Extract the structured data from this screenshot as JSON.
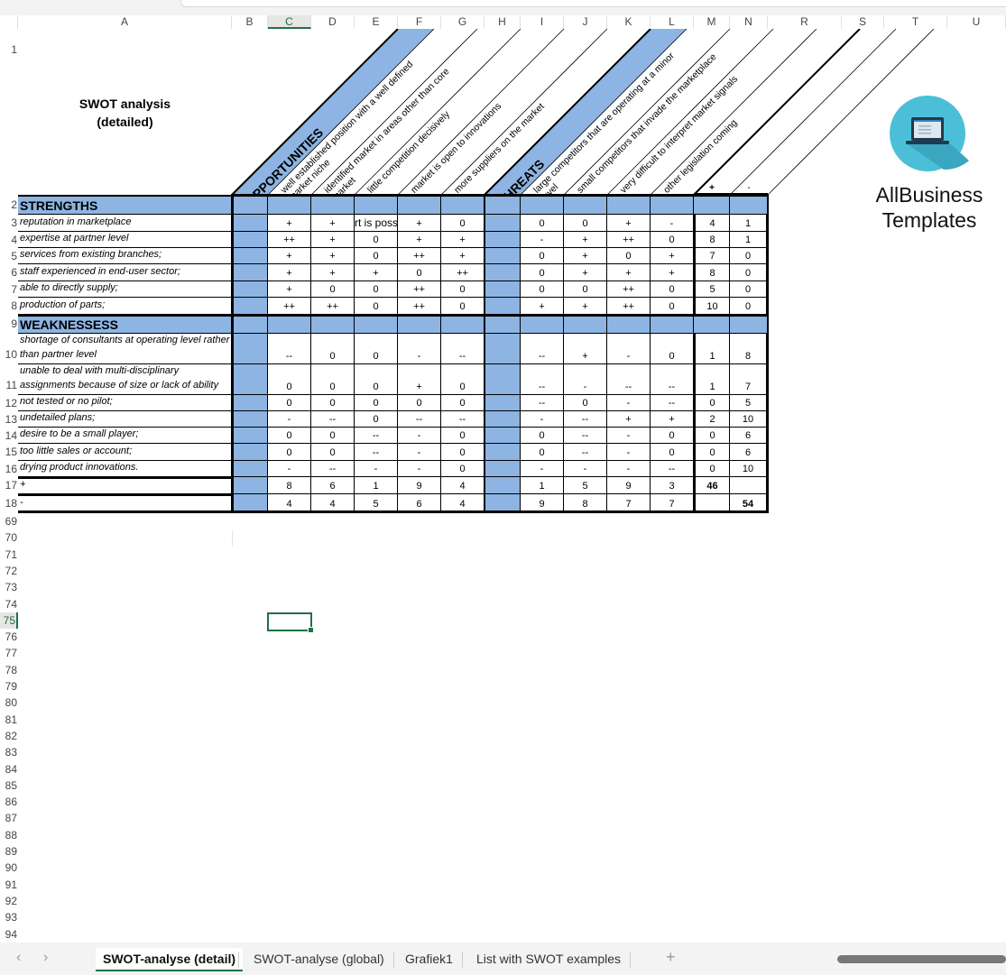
{
  "sheet": {
    "columns": [
      "A",
      "B",
      "C",
      "D",
      "E",
      "F",
      "G",
      "H",
      "I",
      "J",
      "K",
      "L",
      "M",
      "N",
      "R",
      "S",
      "T",
      "U"
    ],
    "selected_column": "C",
    "selected_row": "75",
    "rows_top": [
      "1",
      "2",
      "3",
      "4",
      "5",
      "6",
      "7",
      "8",
      "9",
      "10",
      "11",
      "12",
      "13",
      "14",
      "15",
      "16",
      "17",
      "18"
    ],
    "rows_bottom": [
      "69",
      "70",
      "71",
      "72",
      "73",
      "74",
      "75",
      "76",
      "77",
      "78",
      "79",
      "80",
      "81",
      "82",
      "83",
      "84",
      "85",
      "86",
      "87",
      "88",
      "89",
      "90",
      "91",
      "92",
      "93",
      "94"
    ]
  },
  "title": {
    "line1": "SWOT analysis",
    "line2": "(detailed)"
  },
  "logo": {
    "line1": "AllBusiness",
    "line2": "Templates",
    "icon": "laptop-icon",
    "circle_color": "#4bbfd8"
  },
  "headers": {
    "opportunities": "OPPORTUNITIES",
    "threats": "THREATS",
    "opportunity_items": [
      [
        "well established position with a well defined",
        "market niche"
      ],
      [
        "identified market in areas other than core",
        "market"
      ],
      [
        "little competition decisively",
        ""
      ],
      [
        "market is open to innovations",
        ""
      ],
      [
        "more suppliers on the market",
        ""
      ]
    ],
    "threat_items": [
      [
        "large competitors that are operating at a minor",
        "level"
      ],
      [
        "small competitors that invade the marketplace",
        ""
      ],
      [
        "very difficult to interpret market signals",
        ""
      ],
      [
        "other legislation coming",
        ""
      ]
    ],
    "plus": "+",
    "minus": "-"
  },
  "table": {
    "strengths_label": "STRENGTHS",
    "weaknesses_label": "WEAKNESSESS",
    "strengths": [
      {
        "label": "reputation in marketplace",
        "opp": [
          "+",
          "+",
          "rt is poss",
          "+",
          "0"
        ],
        "thr": [
          "0",
          "0",
          "+",
          "-"
        ],
        "plus": "4",
        "minus": "1"
      },
      {
        "label": "expertise at partner level",
        "opp": [
          "++",
          "+",
          "0",
          "+",
          "+"
        ],
        "thr": [
          "-",
          "+",
          "++",
          "0"
        ],
        "plus": "8",
        "minus": "1"
      },
      {
        "label": "services from existing branches;",
        "opp": [
          "+",
          "+",
          "0",
          "++",
          "+"
        ],
        "thr": [
          "0",
          "+",
          "0",
          "+"
        ],
        "plus": "7",
        "minus": "0"
      },
      {
        "label": "staff experienced in end-user sector;",
        "opp": [
          "+",
          "+",
          "+",
          "0",
          "++"
        ],
        "thr": [
          "0",
          "+",
          "+",
          "+"
        ],
        "plus": "8",
        "minus": "0"
      },
      {
        "label": "able to directly supply;",
        "opp": [
          "+",
          "0",
          "0",
          "++",
          "0"
        ],
        "thr": [
          "0",
          "0",
          "++",
          "0"
        ],
        "plus": "5",
        "minus": "0"
      },
      {
        "label": "production of parts;",
        "opp": [
          "++",
          "++",
          "0",
          "++",
          "0"
        ],
        "thr": [
          "+",
          "+",
          "++",
          "0"
        ],
        "plus": "10",
        "minus": "0"
      }
    ],
    "weaknesses": [
      {
        "label": "shortage of consultants at operating level rather than partner level",
        "opp": [
          "--",
          "0",
          "0",
          "-",
          "--"
        ],
        "thr": [
          "--",
          "+",
          "-",
          "0"
        ],
        "plus": "1",
        "minus": "8"
      },
      {
        "label": "unable to deal with multi-disciplinary assignments because of size or lack of ability",
        "opp": [
          "0",
          "0",
          "0",
          "+",
          "0"
        ],
        "thr": [
          "--",
          "-",
          "--",
          "--"
        ],
        "plus": "1",
        "minus": "7"
      },
      {
        "label": "not tested or no pilot;",
        "opp": [
          "0",
          "0",
          "0",
          "0",
          "0"
        ],
        "thr": [
          "--",
          "0",
          "-",
          "--"
        ],
        "plus": "0",
        "minus": "5"
      },
      {
        "label": "undetailed plans;",
        "opp": [
          "-",
          "--",
          "0",
          "--",
          "--"
        ],
        "thr": [
          "-",
          "--",
          "+",
          "+"
        ],
        "plus": "2",
        "minus": "10"
      },
      {
        "label": "desire to be a small player;",
        "opp": [
          "0",
          "0",
          "--",
          "-",
          "0"
        ],
        "thr": [
          "0",
          "--",
          "-",
          "0"
        ],
        "plus": "0",
        "minus": "6"
      },
      {
        "label": "too little sales or account;",
        "opp": [
          "0",
          "0",
          "--",
          "-",
          "0"
        ],
        "thr": [
          "0",
          "--",
          "-",
          "0"
        ],
        "plus": "0",
        "minus": "6"
      },
      {
        "label": "drying product innovations.",
        "opp": [
          "-",
          "--",
          "-",
          "-",
          "0"
        ],
        "thr": [
          "-",
          "-",
          "-",
          "--"
        ],
        "plus": "0",
        "minus": "10"
      }
    ],
    "totals": [
      {
        "label": "+",
        "opp": [
          "8",
          "6",
          "1",
          "9",
          "4"
        ],
        "thr": [
          "1",
          "5",
          "9",
          "3"
        ],
        "plus": "46",
        "minus": ""
      },
      {
        "label": "-",
        "opp": [
          "4",
          "4",
          "5",
          "6",
          "4"
        ],
        "thr": [
          "9",
          "8",
          "7",
          "7"
        ],
        "plus": "",
        "minus": "54"
      }
    ],
    "band_color": "#8db4e2"
  },
  "tabs": {
    "items": [
      "SWOT-analyse (detail)",
      "SWOT-analyse (global)",
      "Grafiek1",
      "List with SWOT examples"
    ],
    "active": "SWOT-analyse (detail)",
    "add": "+",
    "prev": "‹",
    "next": "›"
  }
}
